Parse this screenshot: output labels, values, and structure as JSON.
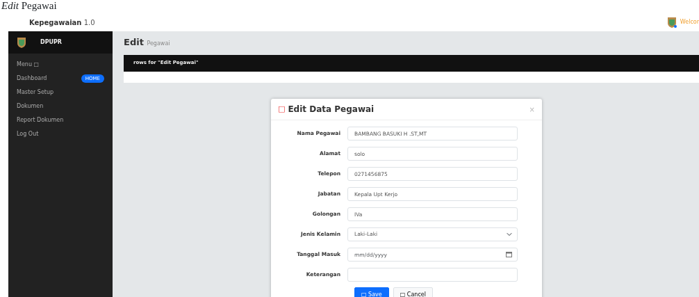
{
  "caption": "*Edit* Pegawai",
  "header": {
    "app_name": "Kepegawaian",
    "version": "1.0",
    "welcome": "Welcor"
  },
  "sidebar": {
    "brand": "DPUPR",
    "menu_label": "Menu",
    "menu_icon": "□",
    "items": [
      {
        "label": "Dashboard",
        "badge": "HOME"
      },
      {
        "label": "Master Setup"
      },
      {
        "label": "Dokumen"
      },
      {
        "label": "Report Dokumen"
      },
      {
        "label": "Log Out"
      }
    ]
  },
  "page": {
    "title": "Edit",
    "subtitle": "Pegawai",
    "panel_heading": "rows for \"Edit Pegawai\""
  },
  "modal": {
    "icon": "□",
    "title": "Edit Data Pegawai",
    "close": "×",
    "fields": [
      {
        "label": "Nama Pegawai",
        "kind": "text",
        "value": "BAMBANG BASUKI H .ST,MT"
      },
      {
        "label": "Alamat",
        "kind": "text",
        "value": "solo"
      },
      {
        "label": "Telepon",
        "kind": "text",
        "value": "0271456875"
      },
      {
        "label": "Jabatan",
        "kind": "text",
        "value": "Kepala Upt Kerjo"
      },
      {
        "label": "Golongan",
        "kind": "text",
        "value": "IVa"
      },
      {
        "label": "Jenis Kelamin",
        "kind": "select",
        "value": "Laki-Laki"
      },
      {
        "label": "Tanggal Masuk",
        "kind": "date",
        "placeholder": "mm/dd/yyyy"
      },
      {
        "label": "Keterangan",
        "kind": "text"
      }
    ],
    "buttons": [
      {
        "icon": "□",
        "label": "Save",
        "kind": "primary"
      },
      {
        "icon": "□",
        "label": "Cancel",
        "kind": "secondary"
      }
    ]
  }
}
